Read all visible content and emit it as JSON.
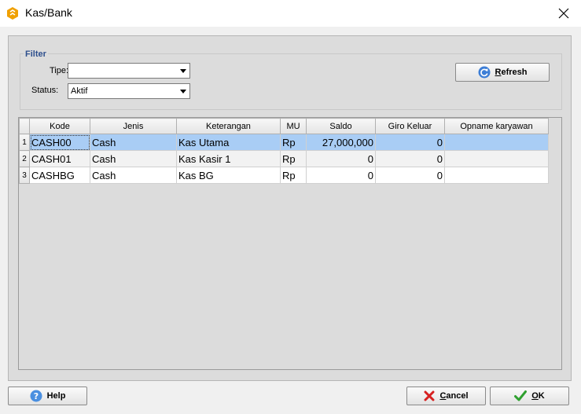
{
  "window": {
    "title": "Kas/Bank"
  },
  "filter": {
    "legend": "Filter",
    "tipe_label": "Tipe:",
    "tipe_value": "",
    "status_label": "Status:",
    "status_value": "Aktif"
  },
  "buttons": {
    "refresh_u": "R",
    "refresh_rest": "efresh",
    "help": "Help",
    "cancel_u": "C",
    "cancel_rest": "ancel",
    "ok_u": "O",
    "ok_rest": "K"
  },
  "grid": {
    "columns": [
      "Kode",
      "Jenis",
      "Keterangan",
      "MU",
      "Saldo",
      "Giro Keluar",
      "Opname karyawan"
    ],
    "rows": [
      {
        "no": "1",
        "kode": "CASH00",
        "jenis": "Cash",
        "keterangan": "Kas Utama",
        "mu": "Rp",
        "saldo": "27,000,000",
        "giro": "0",
        "opname": ""
      },
      {
        "no": "2",
        "kode": "CASH01",
        "jenis": "Cash",
        "keterangan": "Kas Kasir 1",
        "mu": "Rp",
        "saldo": "0",
        "giro": "0",
        "opname": ""
      },
      {
        "no": "3",
        "kode": "CASHBG",
        "jenis": "Cash",
        "keterangan": "Kas BG",
        "mu": "Rp",
        "saldo": "0",
        "giro": "0",
        "opname": ""
      }
    ]
  },
  "colors": {
    "accent": "#2e4f8d",
    "selected_row": "#a9cdf5",
    "icon_orange": "#f0a000"
  }
}
